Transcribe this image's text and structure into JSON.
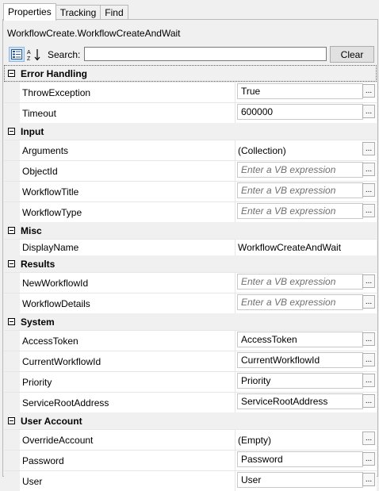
{
  "tabs": [
    "Properties",
    "Tracking",
    "Find"
  ],
  "title": "WorkflowCreate.WorkflowCreateAndWait",
  "toolbar": {
    "search_label": "Search:",
    "search_value": "",
    "clear_label": "Clear"
  },
  "categories": [
    {
      "name": "Error Handling",
      "rows": [
        {
          "name": "ThrowException",
          "value": "True",
          "kind": "box"
        },
        {
          "name": "Timeout",
          "value": "600000",
          "kind": "box"
        }
      ]
    },
    {
      "name": "Input",
      "rows": [
        {
          "name": "Arguments",
          "value": "(Collection)",
          "kind": "text"
        },
        {
          "name": "ObjectId",
          "value": "Enter a VB expression",
          "kind": "placeholder"
        },
        {
          "name": "WorkflowTitle",
          "value": "Enter a VB expression",
          "kind": "placeholder"
        },
        {
          "name": "WorkflowType",
          "value": "Enter a VB expression",
          "kind": "placeholder"
        }
      ]
    },
    {
      "name": "Misc",
      "rows": [
        {
          "name": "DisplayName",
          "value": "WorkflowCreateAndWait",
          "kind": "plain"
        }
      ]
    },
    {
      "name": "Results",
      "rows": [
        {
          "name": "NewWorkflowId",
          "value": "Enter a VB expression",
          "kind": "placeholder"
        },
        {
          "name": "WorkflowDetails",
          "value": "Enter a VB expression",
          "kind": "placeholder"
        }
      ]
    },
    {
      "name": "System",
      "rows": [
        {
          "name": "AccessToken",
          "value": "AccessToken",
          "kind": "box"
        },
        {
          "name": "CurrentWorkflowId",
          "value": "CurrentWorkflowId",
          "kind": "box"
        },
        {
          "name": "Priority",
          "value": "Priority",
          "kind": "box"
        },
        {
          "name": "ServiceRootAddress",
          "value": "ServiceRootAddress",
          "kind": "box"
        }
      ]
    },
    {
      "name": "User Account",
      "rows": [
        {
          "name": "OverrideAccount",
          "value": "(Empty)",
          "kind": "text"
        },
        {
          "name": "Password",
          "value": "Password",
          "kind": "box"
        },
        {
          "name": "User",
          "value": "User",
          "kind": "box"
        }
      ]
    }
  ],
  "icons": {
    "categorized": "categorized-view-icon",
    "alphabetical": "sort-alphabetical-icon",
    "ellipsis": "..."
  }
}
